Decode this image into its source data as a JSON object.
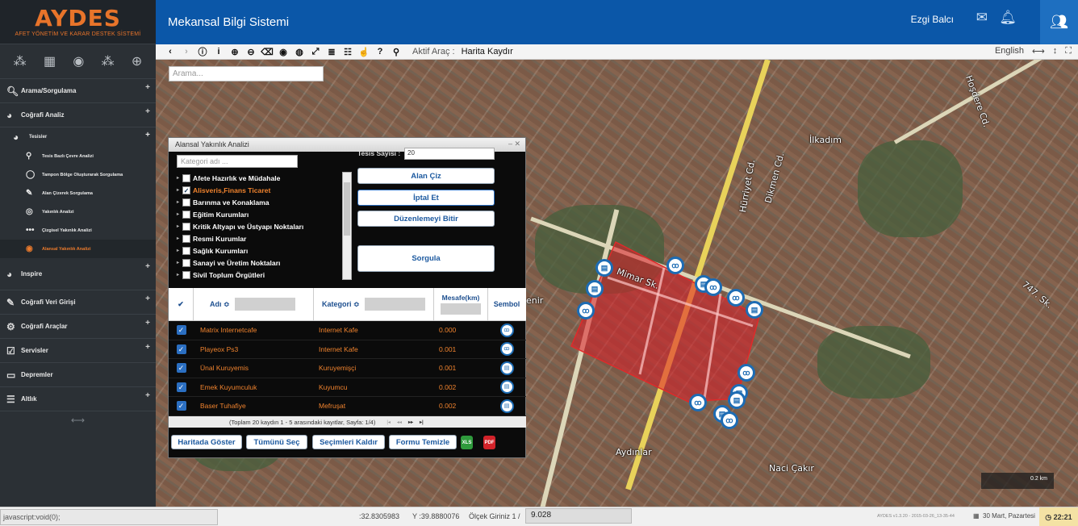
{
  "app": {
    "logo_title": "AYDES",
    "logo_subtitle": "AFET YÖNETİM VE KARAR DESTEK SİSTEMİ",
    "page_title": "Mekansal Bilgi Sistemi",
    "user_name": "Ezgi Balcı"
  },
  "sidebar": {
    "sections": [
      {
        "label": "Arama/Sorgulama"
      },
      {
        "label": "Coğrafi Analiz"
      }
    ],
    "tesisler": {
      "label": "Tesisler",
      "items": [
        {
          "label": "Tesis Bazlı Çevre Analizi"
        },
        {
          "label": "Tampon Bölge Oluşturarak Sorgulama"
        },
        {
          "label": "Alan Çizerek Sorgulama"
        },
        {
          "label": "Yakınlık Analizi"
        },
        {
          "label": "Çizgisel Yakınlık Analizi"
        },
        {
          "label": "Alansal Yakınlık Analizi"
        }
      ]
    },
    "inspire": {
      "label": "Inspire"
    },
    "lower": [
      {
        "label": "Coğrafi Veri Girişi"
      },
      {
        "label": "Coğrafi Araçlar"
      },
      {
        "label": "Servisler"
      },
      {
        "label": "Depremler"
      },
      {
        "label": "Altlık"
      }
    ]
  },
  "toolbar": {
    "active_tool_label": "Aktif Araç :",
    "active_tool_value": "Harita Kaydır",
    "language": "English"
  },
  "map": {
    "search_placeholder": "Arama...",
    "labels": [
      "Mimar Sk.",
      "İlkadım",
      "Hürriyet Cd.",
      "Dikmen Cd.",
      "Aydınlar",
      "Naci Çakır",
      "Hoşdere Cd.",
      "747. Sk.",
      "enir"
    ],
    "scale": "0.2 km"
  },
  "dialog": {
    "title": "Alansal Yakınlık Analizi",
    "category_placeholder": "Kategori adı ...",
    "categories": [
      {
        "label": "Afete Hazırlık ve Müdahale",
        "checked": false
      },
      {
        "label": "Alisveris,Finans Ticaret",
        "checked": true
      },
      {
        "label": "Barınma ve Konaklama",
        "checked": false
      },
      {
        "label": "Eğitim Kurumları",
        "checked": false
      },
      {
        "label": "Kritik Altyapı ve Üstyapı Noktaları",
        "checked": false
      },
      {
        "label": "Resmi Kurumlar",
        "checked": false
      },
      {
        "label": "Sağlık Kurumları",
        "checked": false
      },
      {
        "label": "Sanayi ve Üretim Noktaları",
        "checked": false
      },
      {
        "label": "Sivil Toplum Örgütleri",
        "checked": false
      }
    ],
    "tesis_label": "Tesis Sayısı :",
    "tesis_value": "20",
    "buttons": {
      "alan_ciz": "Alan Çiz",
      "iptal_et": "İptal Et",
      "duzenlemeyi_bitir": "Düzenlemeyi Bitir",
      "sorgula": "Sorgula"
    },
    "grid": {
      "headers": {
        "ad": "Adı ≎",
        "kategori": "Kategori ≎",
        "mesafe": "Mesafe(km)",
        "sembol": "Sembol"
      },
      "rows": [
        {
          "name": "Matrix Internetcafe",
          "category": "Internet Kafe",
          "distance": "0.000"
        },
        {
          "name": "Playeox Ps3",
          "category": "Internet Kafe",
          "distance": "0.001"
        },
        {
          "name": "Ünal Kuruyemis",
          "category": "Kuruyemişçi",
          "distance": "0.001"
        },
        {
          "name": "Emek Kuyumculuk",
          "category": "Kuyumcu",
          "distance": "0.002"
        },
        {
          "name": "Baser Tuhafiye",
          "category": "Mefruşat",
          "distance": "0.002"
        }
      ],
      "footer": "(Toplam 20 kaydın 1 - 5 arasındaki kayıtlar, Sayfa: 1/4)"
    },
    "footer_buttons": {
      "haritada_goster": "Haritada Göster",
      "tumunu_sec": "Tümünü Seç",
      "secimleri_kaldir": "Seçimleri Kaldır",
      "formu_temizle": "Formu Temizle"
    }
  },
  "status": {
    "js_tip": "javascript:void(0);",
    "x_coord": ":32.8305983",
    "y_coord": "Y :39.8880076",
    "scale_label": "Ölçek Giriniz 1 /",
    "scale_value": "9.028",
    "version": "AYDES v1.3.20 - 2015-03-26_13-35-44",
    "date": "30 Mart, Pazartesi",
    "time": "22:21"
  }
}
